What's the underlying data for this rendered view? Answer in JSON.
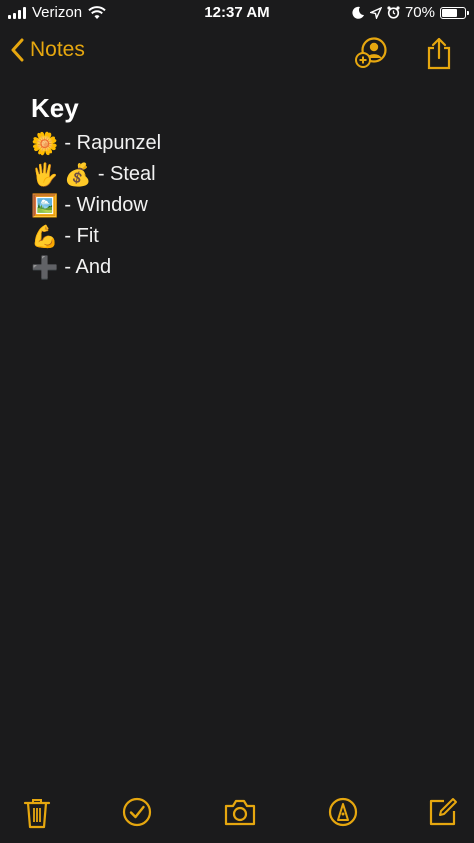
{
  "status_bar": {
    "carrier": "Verizon",
    "time": "12:37 AM",
    "battery_percent": "70%",
    "battery_level": 0.7
  },
  "nav": {
    "back_label": "Notes",
    "accent_color": "#e6a70f"
  },
  "note": {
    "title": "Key",
    "lines": [
      {
        "icons": [
          "🌼"
        ],
        "text": "- Rapunzel"
      },
      {
        "icons": [
          "🖐",
          "💰"
        ],
        "text": " - Steal"
      },
      {
        "icons": [
          "🖼️"
        ],
        "text": "- Window"
      },
      {
        "icons": [
          "💪"
        ],
        "text": "- Fit"
      },
      {
        "icons": [
          "➕"
        ],
        "text": "- And"
      }
    ]
  },
  "toolbar": {
    "icons": [
      "trash-icon",
      "checklist-icon",
      "camera-icon",
      "markup-icon",
      "compose-icon"
    ]
  }
}
